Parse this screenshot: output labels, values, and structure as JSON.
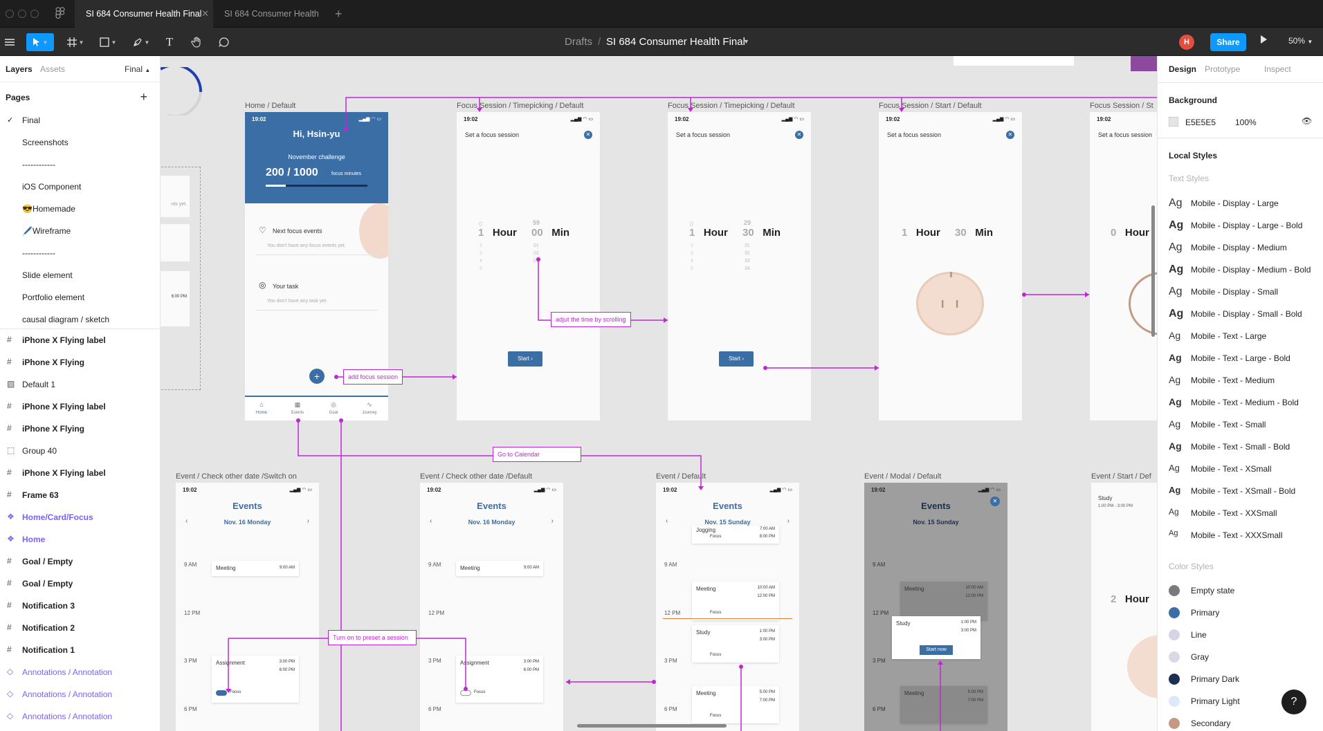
{
  "titlebar": {
    "tabs": [
      {
        "label": "SI 684 Consumer Health Final",
        "active": true
      },
      {
        "label": "SI 684 Consumer Health",
        "active": false
      }
    ]
  },
  "toolbar": {
    "breadcrumb_root": "Drafts",
    "breadcrumb_sep": "/",
    "file_name": "SI 684 Consumer Health Final",
    "avatar_initial": "H",
    "share_label": "Share",
    "zoom": "50%"
  },
  "left_panel": {
    "tabs": [
      "Layers",
      "Assets"
    ],
    "page_selector": "Final",
    "pages_heading": "Pages",
    "pages": [
      "Final",
      "Screenshots",
      "------------",
      "iOS Component",
      "😎Homemade",
      "🖊️Wireframe",
      "------------",
      "Slide element",
      "Portfolio element",
      "causal diagram / sketch"
    ],
    "layers": [
      {
        "label": "iPhone X Flying label",
        "icon": "#"
      },
      {
        "label": "iPhone X Flying",
        "icon": "#"
      },
      {
        "label": "Default 1",
        "icon": "▧"
      },
      {
        "label": "iPhone X Flying label",
        "icon": "#"
      },
      {
        "label": "iPhone X Flying",
        "icon": "#"
      },
      {
        "label": "Group 40",
        "icon": "⬚"
      },
      {
        "label": "iPhone X Flying label",
        "icon": "#"
      },
      {
        "label": "Frame 63",
        "icon": "#"
      },
      {
        "label": "Home/Card/Focus",
        "icon": "❖"
      },
      {
        "label": "Home",
        "icon": "❖"
      },
      {
        "label": "Goal / Empty",
        "icon": "#"
      },
      {
        "label": "Goal / Empty",
        "icon": "#"
      },
      {
        "label": "Notification 3",
        "icon": "#"
      },
      {
        "label": "Notification 2",
        "icon": "#"
      },
      {
        "label": "Notification 1",
        "icon": "#"
      },
      {
        "label": "Annotations / Annotation",
        "icon": "◇"
      },
      {
        "label": "Annotations / Annotation",
        "icon": "◇"
      },
      {
        "label": "Annotations / Annotation",
        "icon": "◇"
      }
    ]
  },
  "right_panel": {
    "tabs": [
      "Design",
      "Prototype",
      "Inspect"
    ],
    "background_heading": "Background",
    "bg_hex": "E5E5E5",
    "bg_opacity": "100%",
    "local_styles": "Local Styles",
    "text_styles_heading": "Text Styles",
    "text_styles": [
      "Mobile - Display - Large",
      "Mobile - Display - Large - Bold",
      "Mobile - Display - Medium",
      "Mobile - Display - Medium - Bold",
      "Mobile - Display - Small",
      "Mobile - Display - Small - Bold",
      "Mobile - Text - Large",
      "Mobile - Text - Large - Bold",
      "Mobile - Text - Medium",
      "Mobile - Text - Medium - Bold",
      "Mobile - Text - Small",
      "Mobile - Text - Small - Bold",
      "Mobile - Text - XSmall",
      "Mobile - Text - XSmall - Bold",
      "Mobile - Text - XXSmall",
      "Mobile - Text - XXXSmall"
    ],
    "ag": "Ag",
    "color_styles_heading": "Color Styles",
    "color_styles": [
      {
        "name": "Empty state",
        "color": "#7a7a7a"
      },
      {
        "name": "Primary",
        "color": "#3b6ea5"
      },
      {
        "name": "Line",
        "color": "#d5d5e5"
      },
      {
        "name": "Gray",
        "color": "#d9d9e6"
      },
      {
        "name": "Primary Dark",
        "color": "#1d2f50"
      },
      {
        "name": "Primary Light",
        "color": "#dde9f7"
      },
      {
        "name": "Secondary",
        "color": "#c49a82"
      }
    ],
    "help": "?"
  },
  "canvas": {
    "frame_labels": {
      "home": "Home / Default",
      "timepick1": "Focus Session / Timepicking / Default",
      "timepick2": "Focus Session / Timepicking / Default",
      "start": "Focus Session / Start / Default",
      "start2": "Focus Session / St",
      "ev_switch": "Event / Check other date /Switch on",
      "ev_check": "Event / Check other date /Default",
      "ev_default": "Event / Default",
      "ev_modal": "Event / Modal / Default",
      "ev_start": "Event / Start / Def"
    },
    "home": {
      "time": "19:02",
      "greeting": "Hi, Hsin-yu",
      "challenge": "November challenge",
      "progress_text": "200 / 1000",
      "progress_unit": "focus minutes",
      "progress": 0.2,
      "next_events": "Next focus events",
      "no_events": "You don't have any focus events yet.",
      "your_task": "Your task",
      "no_task": "You don't have any task yet.",
      "nav": [
        "Home",
        "Events",
        "Goal",
        "Journey"
      ]
    },
    "focus": {
      "time": "19:02",
      "title": "Set a focus session",
      "hour": "Hour",
      "min": "Min",
      "start": "Start",
      "f1_hour": "1",
      "f1_min": "00",
      "f2_hour": "1",
      "f2_min": "30",
      "f3_hour": "1",
      "f3_min": "30",
      "f4_hour": "0",
      "f1_min_above": "59",
      "f2_min_above": "29",
      "f1_hour_above": "0",
      "f2_hour_above": "0",
      "hours_below": [
        "2",
        "3",
        "4",
        "5"
      ],
      "f1_mins_below": [
        "01",
        "02",
        "03"
      ],
      "f2_mins_below": [
        "31",
        "32",
        "33",
        "34"
      ]
    },
    "annotations": {
      "add_focus": "add focus session",
      "adjust_time": "adjut the time by scrolling",
      "go_calendar": "Go to Calendar",
      "preset": "Turn on to preset a session"
    },
    "events": {
      "time": "19:02",
      "title": "Events",
      "date_a": "Nov. 16 Monday",
      "date_b": "Nov. 15 Sunday",
      "t9": "9 AM",
      "t12": "12 PM",
      "t3": "3 PM",
      "t6": "6 PM",
      "meeting": "Meeting",
      "meeting_time": "9:00 AM",
      "assignment": "Assignment",
      "asg_start": "3:00 PM",
      "asg_end": "6:00 PM",
      "focus": "Focus",
      "jogging": "Jogging",
      "jog_start": "7:00 AM",
      "jog_end": "8:00 PM",
      "m2_start": "10:00 AM",
      "m2_end": "12:00 PM",
      "study": "Study",
      "study_start": "1:00 PM",
      "study_end": "3:00 PM",
      "m3_start": "5:00 PM",
      "m3_end": "7:00 PM",
      "start_now": "Start now",
      "study_range": "1:00 PM - 3:00 PM",
      "side_hour": "2",
      "side_hour_label": "Hour"
    },
    "partial": {
      "yet": "nts yet.",
      "pm": "6:00 PM"
    }
  }
}
